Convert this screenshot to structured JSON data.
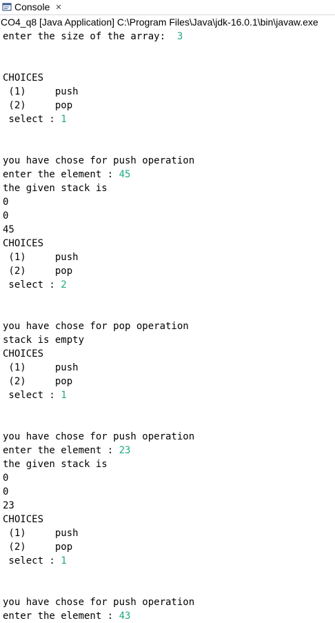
{
  "tab": {
    "title": "Console",
    "icon": "console-icon",
    "close_icon": "close-icon",
    "close_glyph": "✕"
  },
  "launch": {
    "text": "CO4_q8 [Java Application] C:\\Program Files\\Java\\jdk-16.0.1\\bin\\javaw.exe"
  },
  "colors": {
    "user_input": "#1fa783",
    "text": "#000000"
  },
  "lines": [
    {
      "text": "enter the size of the array:  ",
      "input": "3"
    },
    {
      "text": "",
      "input": ""
    },
    {
      "text": "",
      "input": ""
    },
    {
      "text": "CHOICES",
      "input": ""
    },
    {
      "text": " (1)     push",
      "input": ""
    },
    {
      "text": " (2)     pop",
      "input": ""
    },
    {
      "text": " select : ",
      "input": "1"
    },
    {
      "text": "",
      "input": ""
    },
    {
      "text": "",
      "input": ""
    },
    {
      "text": "you have chose for push operation",
      "input": ""
    },
    {
      "text": "enter the element : ",
      "input": "45"
    },
    {
      "text": "the given stack is",
      "input": ""
    },
    {
      "text": "0",
      "input": ""
    },
    {
      "text": "0",
      "input": ""
    },
    {
      "text": "45",
      "input": ""
    },
    {
      "text": "CHOICES",
      "input": ""
    },
    {
      "text": " (1)     push",
      "input": ""
    },
    {
      "text": " (2)     pop",
      "input": ""
    },
    {
      "text": " select : ",
      "input": "2"
    },
    {
      "text": "",
      "input": ""
    },
    {
      "text": "",
      "input": ""
    },
    {
      "text": "you have chose for pop operation",
      "input": ""
    },
    {
      "text": "stack is empty",
      "input": ""
    },
    {
      "text": "CHOICES",
      "input": ""
    },
    {
      "text": " (1)     push",
      "input": ""
    },
    {
      "text": " (2)     pop",
      "input": ""
    },
    {
      "text": " select : ",
      "input": "1"
    },
    {
      "text": "",
      "input": ""
    },
    {
      "text": "",
      "input": ""
    },
    {
      "text": "you have chose for push operation",
      "input": ""
    },
    {
      "text": "enter the element : ",
      "input": "23"
    },
    {
      "text": "the given stack is",
      "input": ""
    },
    {
      "text": "0",
      "input": ""
    },
    {
      "text": "0",
      "input": ""
    },
    {
      "text": "23",
      "input": ""
    },
    {
      "text": "CHOICES",
      "input": ""
    },
    {
      "text": " (1)     push",
      "input": ""
    },
    {
      "text": " (2)     pop",
      "input": ""
    },
    {
      "text": " select : ",
      "input": "1"
    },
    {
      "text": "",
      "input": ""
    },
    {
      "text": "",
      "input": ""
    },
    {
      "text": "you have chose for push operation",
      "input": ""
    },
    {
      "text": "enter the element : ",
      "input": "43"
    }
  ]
}
